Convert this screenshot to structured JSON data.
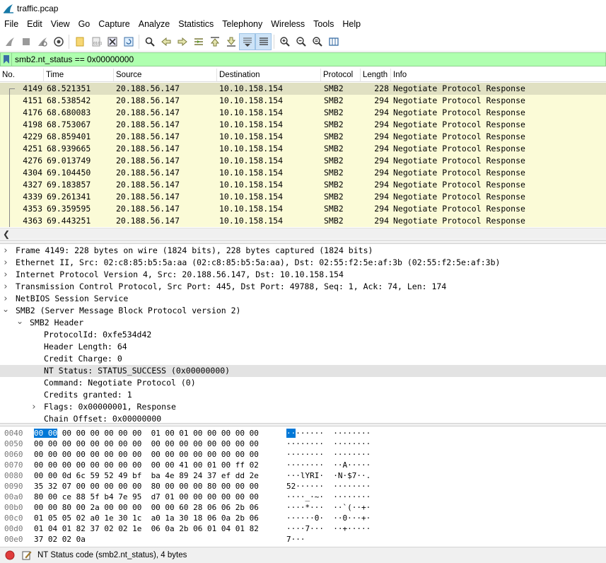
{
  "window": {
    "title": "traffic.pcap",
    "icon": "wireshark-fin-icon"
  },
  "menu": [
    "File",
    "Edit",
    "View",
    "Go",
    "Capture",
    "Analyze",
    "Statistics",
    "Telephony",
    "Wireless",
    "Tools",
    "Help"
  ],
  "toolbar": {
    "icons": [
      "start-capture-icon",
      "stop-capture-icon",
      "restart-capture-icon",
      "capture-options-icon",
      "open-file-icon",
      "save-file-icon",
      "close-file-icon",
      "reload-file-icon",
      "find-packet-icon",
      "go-back-icon",
      "go-forward-icon",
      "go-to-packet-icon",
      "first-packet-icon",
      "last-packet-icon",
      "autoscroll-icon",
      "colorize-icon",
      "zoom-in-icon",
      "zoom-out-icon",
      "normal-size-icon",
      "resize-columns-icon"
    ]
  },
  "filter": {
    "value": "smb2.nt_status == 0x00000000"
  },
  "columns": [
    "No.",
    "Time",
    "Source",
    "Destination",
    "Protocol",
    "Length",
    "Info"
  ],
  "packets": [
    {
      "no": "4149",
      "time": "68.521351",
      "src": "20.188.56.147",
      "dst": "10.10.158.154",
      "proto": "SMB2",
      "len": "228",
      "info": "Negotiate Protocol Response"
    },
    {
      "no": "4151",
      "time": "68.538542",
      "src": "20.188.56.147",
      "dst": "10.10.158.154",
      "proto": "SMB2",
      "len": "294",
      "info": "Negotiate Protocol Response"
    },
    {
      "no": "4176",
      "time": "68.680083",
      "src": "20.188.56.147",
      "dst": "10.10.158.154",
      "proto": "SMB2",
      "len": "294",
      "info": "Negotiate Protocol Response"
    },
    {
      "no": "4198",
      "time": "68.753067",
      "src": "20.188.56.147",
      "dst": "10.10.158.154",
      "proto": "SMB2",
      "len": "294",
      "info": "Negotiate Protocol Response"
    },
    {
      "no": "4229",
      "time": "68.859401",
      "src": "20.188.56.147",
      "dst": "10.10.158.154",
      "proto": "SMB2",
      "len": "294",
      "info": "Negotiate Protocol Response"
    },
    {
      "no": "4251",
      "time": "68.939665",
      "src": "20.188.56.147",
      "dst": "10.10.158.154",
      "proto": "SMB2",
      "len": "294",
      "info": "Negotiate Protocol Response"
    },
    {
      "no": "4276",
      "time": "69.013749",
      "src": "20.188.56.147",
      "dst": "10.10.158.154",
      "proto": "SMB2",
      "len": "294",
      "info": "Negotiate Protocol Response"
    },
    {
      "no": "4304",
      "time": "69.104450",
      "src": "20.188.56.147",
      "dst": "10.10.158.154",
      "proto": "SMB2",
      "len": "294",
      "info": "Negotiate Protocol Response"
    },
    {
      "no": "4327",
      "time": "69.183857",
      "src": "20.188.56.147",
      "dst": "10.10.158.154",
      "proto": "SMB2",
      "len": "294",
      "info": "Negotiate Protocol Response"
    },
    {
      "no": "4339",
      "time": "69.261341",
      "src": "20.188.56.147",
      "dst": "10.10.158.154",
      "proto": "SMB2",
      "len": "294",
      "info": "Negotiate Protocol Response"
    },
    {
      "no": "4353",
      "time": "69.359595",
      "src": "20.188.56.147",
      "dst": "10.10.158.154",
      "proto": "SMB2",
      "len": "294",
      "info": "Negotiate Protocol Response"
    },
    {
      "no": "4363",
      "time": "69.443251",
      "src": "20.188.56.147",
      "dst": "10.10.158.154",
      "proto": "SMB2",
      "len": "294",
      "info": "Negotiate Protocol Response"
    }
  ],
  "details": [
    {
      "text": "Frame 4149: 228 bytes on wire (1824 bits), 228 bytes captured (1824 bits)",
      "level": 0,
      "toggle": "collapsed"
    },
    {
      "text": "Ethernet II, Src: 02:c8:85:b5:5a:aa (02:c8:85:b5:5a:aa), Dst: 02:55:f2:5e:af:3b (02:55:f2:5e:af:3b)",
      "level": 0,
      "toggle": "collapsed"
    },
    {
      "text": "Internet Protocol Version 4, Src: 20.188.56.147, Dst: 10.10.158.154",
      "level": 0,
      "toggle": "collapsed"
    },
    {
      "text": "Transmission Control Protocol, Src Port: 445, Dst Port: 49788, Seq: 1, Ack: 74, Len: 174",
      "level": 0,
      "toggle": "collapsed"
    },
    {
      "text": "NetBIOS Session Service",
      "level": 0,
      "toggle": "collapsed"
    },
    {
      "text": "SMB2 (Server Message Block Protocol version 2)",
      "level": 0,
      "toggle": "expanded"
    },
    {
      "text": "SMB2 Header",
      "level": 1,
      "toggle": "expanded"
    },
    {
      "text": "ProtocolId: 0xfe534d42",
      "level": 2,
      "toggle": "none"
    },
    {
      "text": "Header Length: 64",
      "level": 2,
      "toggle": "none"
    },
    {
      "text": "Credit Charge: 0",
      "level": 2,
      "toggle": "none"
    },
    {
      "text": "NT Status: STATUS_SUCCESS (0x00000000)",
      "level": 2,
      "toggle": "none",
      "selected": true
    },
    {
      "text": "Command: Negotiate Protocol (0)",
      "level": 2,
      "toggle": "none"
    },
    {
      "text": "Credits granted: 1",
      "level": 2,
      "toggle": "none"
    },
    {
      "text": "Flags: 0x00000001, Response",
      "level": 2,
      "toggle": "collapsed"
    },
    {
      "text": "Chain Offset: 0x00000000",
      "level": 2,
      "toggle": "none"
    }
  ],
  "bytes": [
    {
      "off": "0040",
      "hl": "00 00",
      "hex": " 00 00 00 00 00 00  01 00 01 00 00 00 00 00",
      "hlAsc": "··",
      "asc": "······  ········"
    },
    {
      "off": "0050",
      "hl": "",
      "hex": "00 00 00 00 00 00 00 00  00 00 00 00 00 00 00 00",
      "hlAsc": "",
      "asc": "········  ········"
    },
    {
      "off": "0060",
      "hl": "",
      "hex": "00 00 00 00 00 00 00 00  00 00 00 00 00 00 00 00",
      "hlAsc": "",
      "asc": "········  ········"
    },
    {
      "off": "0070",
      "hl": "",
      "hex": "00 00 00 00 00 00 00 00  00 00 41 00 01 00 ff 02",
      "hlAsc": "",
      "asc": "········  ··A·····"
    },
    {
      "off": "0080",
      "hl": "",
      "hex": "00 00 0d 6c 59 52 49 bf  ba 4e 89 24 37 ef dd 2e",
      "hlAsc": "",
      "asc": "···lYRI·  ·N·$7··."
    },
    {
      "off": "0090",
      "hl": "",
      "hex": "35 32 07 00 00 00 00 00  80 00 00 00 80 00 00 00",
      "hlAsc": "",
      "asc": "52······  ········"
    },
    {
      "off": "00a0",
      "hl": "",
      "hex": "80 00 ce 88 5f b4 7e 95  d7 01 00 00 00 00 00 00",
      "hlAsc": "",
      "asc": "····_·~·  ········"
    },
    {
      "off": "00b0",
      "hl": "",
      "hex": "00 00 80 00 2a 00 00 00  00 00 60 28 06 06 2b 06",
      "hlAsc": "",
      "asc": "····*···  ··`(··+·"
    },
    {
      "off": "00c0",
      "hl": "",
      "hex": "01 05 05 02 a0 1e 30 1c  a0 1a 30 18 06 0a 2b 06",
      "hlAsc": "",
      "asc": "······0·  ··0···+·"
    },
    {
      "off": "00d0",
      "hl": "",
      "hex": "01 04 01 82 37 02 02 1e  06 0a 2b 06 01 04 01 82",
      "hlAsc": "",
      "asc": "····7···  ··+·····"
    },
    {
      "off": "00e0",
      "hl": "",
      "hex": "37 02 02 0a",
      "hlAsc": "",
      "asc": "7···"
    }
  ],
  "status": {
    "text": "NT Status code (smb2.nt_status), 4 bytes",
    "ready_icon": "expert-info-red-icon",
    "edit_icon": "capture-comment-icon"
  }
}
